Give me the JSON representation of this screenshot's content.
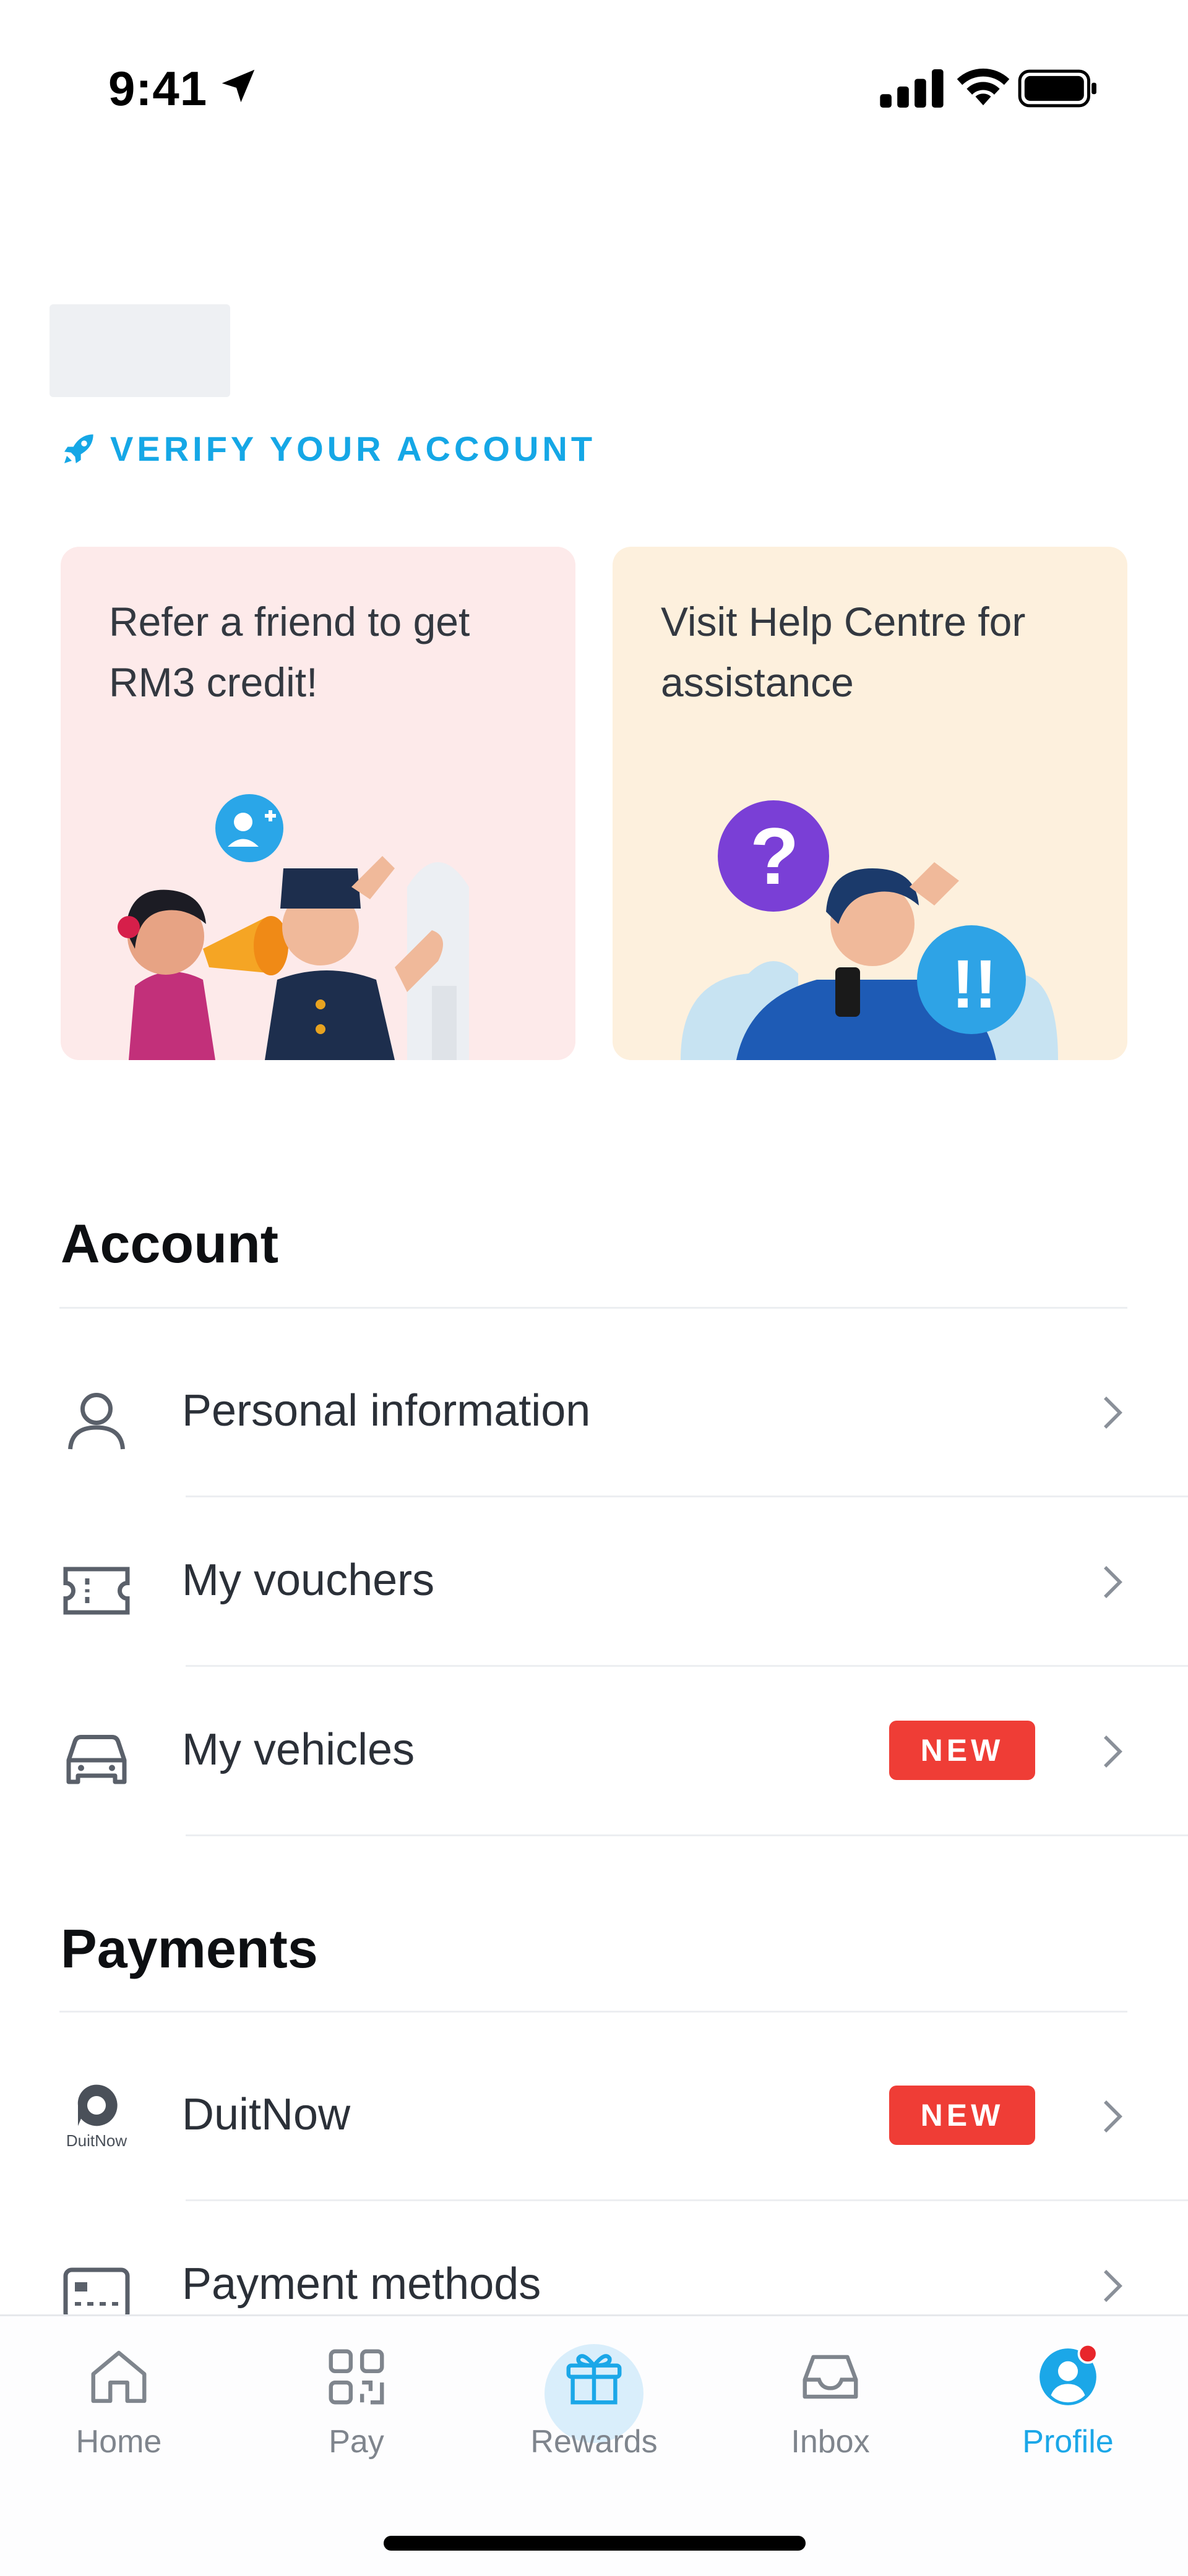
{
  "status_bar": {
    "time": "9:41"
  },
  "verify": {
    "label": "VERIFY YOUR ACCOUNT"
  },
  "promos": [
    {
      "text": "Refer a friend to get RM3 credit!"
    },
    {
      "text": "Visit Help Centre for assistance"
    }
  ],
  "account": {
    "title": "Account",
    "items": [
      {
        "label": "Personal information",
        "icon": "user-icon"
      },
      {
        "label": "My vouchers",
        "icon": "voucher-icon"
      },
      {
        "label": "My vehicles",
        "icon": "car-icon",
        "badge": "NEW"
      }
    ]
  },
  "payments": {
    "title": "Payments",
    "items": [
      {
        "label": "DuitNow",
        "icon": "duitnow-logo",
        "badge": "NEW",
        "logo_text": "DuitNow"
      },
      {
        "label": "Payment methods",
        "icon": "card-icon"
      }
    ]
  },
  "tabs": [
    {
      "label": "Home",
      "icon": "home-icon"
    },
    {
      "label": "Pay",
      "icon": "qr-icon"
    },
    {
      "label": "Rewards",
      "icon": "gift-icon"
    },
    {
      "label": "Inbox",
      "icon": "inbox-icon"
    },
    {
      "label": "Profile",
      "icon": "profile-icon",
      "active": true
    }
  ],
  "colors": {
    "accent": "#1ba7e8",
    "badge": "#ef3d36",
    "refer_card": "#fdeaea",
    "help_card": "#fdf0dd"
  }
}
